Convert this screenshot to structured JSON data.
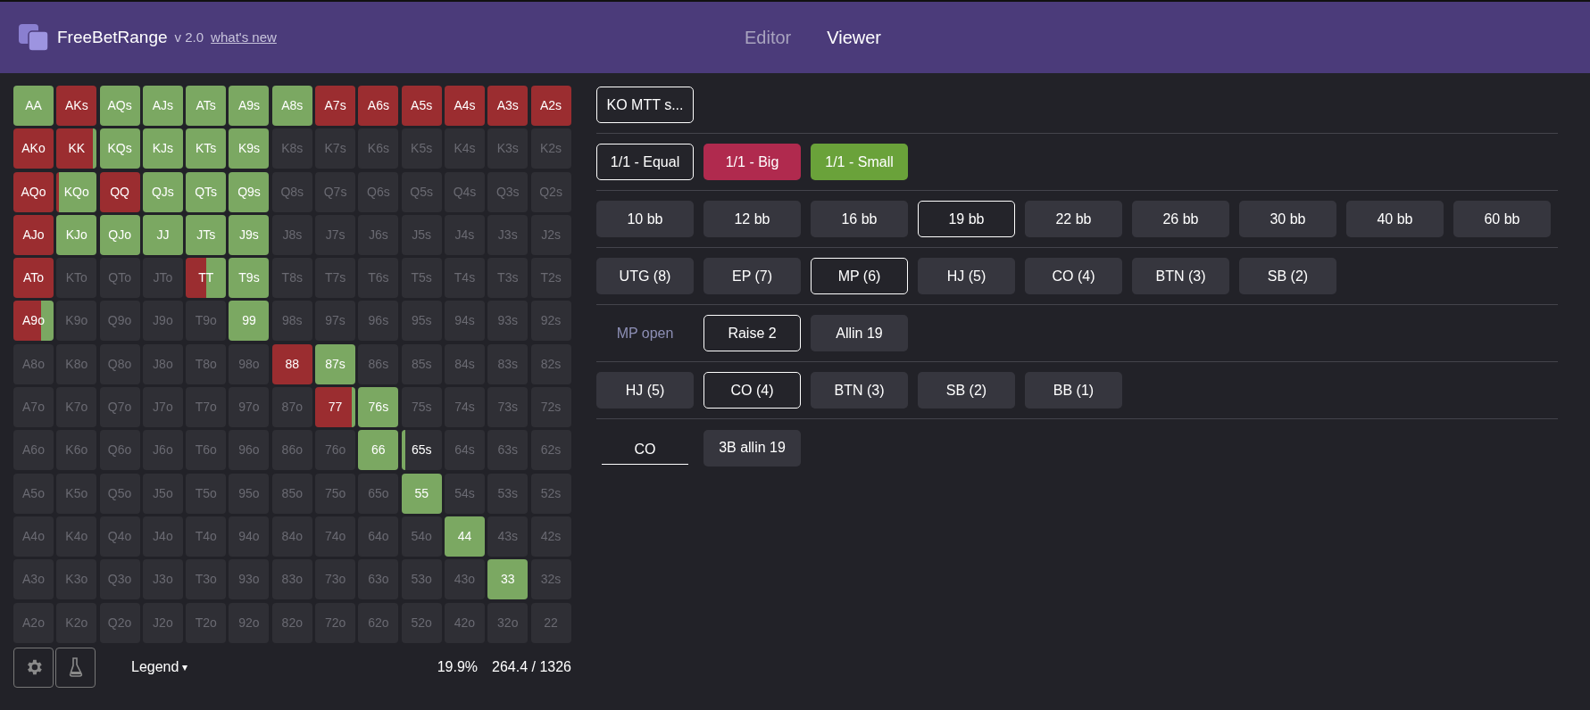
{
  "header": {
    "brand": "FreeBetRange",
    "version": "v 2.0",
    "link": "what's new",
    "tabs": [
      {
        "label": "Editor",
        "selected": false
      },
      {
        "label": "Viewer",
        "selected": true
      }
    ]
  },
  "grid": [
    [
      {
        "label": "AA",
        "actions": [
          {
            "color": "#7ba862",
            "level": 1
          }
        ]
      },
      {
        "label": "AKs",
        "actions": [
          {
            "color": "#9b2d30",
            "level": 1
          }
        ]
      },
      {
        "label": "AQs",
        "actions": [
          {
            "color": "#7ba862",
            "level": 1
          }
        ]
      },
      {
        "label": "AJs",
        "actions": [
          {
            "color": "#7ba862",
            "level": 1
          }
        ]
      },
      {
        "label": "ATs",
        "actions": [
          {
            "color": "#7ba862",
            "level": 1
          }
        ]
      },
      {
        "label": "A9s",
        "actions": [
          {
            "color": "#7ba862",
            "level": 1
          }
        ]
      },
      {
        "label": "A8s",
        "actions": [
          {
            "color": "#7ba862",
            "level": 1
          }
        ]
      },
      {
        "label": "A7s",
        "actions": [
          {
            "color": "#9b2d30",
            "level": 1
          }
        ]
      },
      {
        "label": "A6s",
        "actions": [
          {
            "color": "#9b2d30",
            "level": 1
          }
        ]
      },
      {
        "label": "A5s",
        "actions": [
          {
            "color": "#9b2d30",
            "level": 1
          }
        ]
      },
      {
        "label": "A4s",
        "actions": [
          {
            "color": "#9b2d30",
            "level": 1
          }
        ]
      },
      {
        "label": "A3s",
        "actions": [
          {
            "color": "#9b2d30",
            "level": 1
          }
        ]
      },
      {
        "label": "A2s",
        "actions": [
          {
            "color": "#9b2d30",
            "level": 1
          }
        ]
      }
    ],
    [
      {
        "label": "AKo",
        "actions": [
          {
            "color": "#9b2d30",
            "level": 1
          }
        ]
      },
      {
        "label": "KK",
        "actions": [
          {
            "color": "#9b2d30",
            "level": 0.9
          },
          {
            "color": "#7ba862",
            "level": 0.1
          }
        ]
      },
      {
        "label": "KQs",
        "actions": [
          {
            "color": "#7ba862",
            "level": 1
          }
        ]
      },
      {
        "label": "KJs",
        "actions": [
          {
            "color": "#7ba862",
            "level": 1
          }
        ]
      },
      {
        "label": "KTs",
        "actions": [
          {
            "color": "#7ba862",
            "level": 1
          }
        ]
      },
      {
        "label": "K9s",
        "actions": [
          {
            "color": "#7ba862",
            "level": 1
          }
        ]
      },
      {
        "label": "K8s"
      },
      {
        "label": "K7s"
      },
      {
        "label": "K6s"
      },
      {
        "label": "K5s"
      },
      {
        "label": "K4s"
      },
      {
        "label": "K3s"
      },
      {
        "label": "K2s"
      }
    ],
    [
      {
        "label": "AQo",
        "actions": [
          {
            "color": "#9b2d30",
            "level": 1
          }
        ]
      },
      {
        "label": "KQo",
        "actions": [
          {
            "color": "#9b2d30",
            "level": 0.05
          },
          {
            "color": "#7ba862",
            "level": 0.95
          }
        ]
      },
      {
        "label": "QQ",
        "actions": [
          {
            "color": "#9b2d30",
            "level": 1
          }
        ]
      },
      {
        "label": "QJs",
        "actions": [
          {
            "color": "#7ba862",
            "level": 1
          }
        ]
      },
      {
        "label": "QTs",
        "actions": [
          {
            "color": "#7ba862",
            "level": 1
          }
        ]
      },
      {
        "label": "Q9s",
        "actions": [
          {
            "color": "#7ba862",
            "level": 1
          }
        ]
      },
      {
        "label": "Q8s"
      },
      {
        "label": "Q7s"
      },
      {
        "label": "Q6s"
      },
      {
        "label": "Q5s"
      },
      {
        "label": "Q4s"
      },
      {
        "label": "Q3s"
      },
      {
        "label": "Q2s"
      }
    ],
    [
      {
        "label": "AJo",
        "actions": [
          {
            "color": "#9b2d30",
            "level": 1
          }
        ]
      },
      {
        "label": "KJo",
        "actions": [
          {
            "color": "#7ba862",
            "level": 1
          }
        ]
      },
      {
        "label": "QJo",
        "actions": [
          {
            "color": "#7ba862",
            "level": 1
          }
        ]
      },
      {
        "label": "JJ",
        "actions": [
          {
            "color": "#7ba862",
            "level": 1
          }
        ]
      },
      {
        "label": "JTs",
        "actions": [
          {
            "color": "#7ba862",
            "level": 1
          }
        ]
      },
      {
        "label": "J9s",
        "actions": [
          {
            "color": "#7ba862",
            "level": 1
          }
        ]
      },
      {
        "label": "J8s"
      },
      {
        "label": "J7s"
      },
      {
        "label": "J6s"
      },
      {
        "label": "J5s"
      },
      {
        "label": "J4s"
      },
      {
        "label": "J3s"
      },
      {
        "label": "J2s"
      }
    ],
    [
      {
        "label": "ATo",
        "actions": [
          {
            "color": "#9b2d30",
            "level": 1
          }
        ]
      },
      {
        "label": "KTo"
      },
      {
        "label": "QTo"
      },
      {
        "label": "JTo"
      },
      {
        "label": "TT",
        "actions": [
          {
            "color": "#9b2d30",
            "level": 0.5
          },
          {
            "color": "#7ba862",
            "level": 0.5
          }
        ]
      },
      {
        "label": "T9s",
        "actions": [
          {
            "color": "#7ba862",
            "level": 1
          }
        ]
      },
      {
        "label": "T8s"
      },
      {
        "label": "T7s"
      },
      {
        "label": "T6s"
      },
      {
        "label": "T5s"
      },
      {
        "label": "T4s"
      },
      {
        "label": "T3s"
      },
      {
        "label": "T2s"
      }
    ],
    [
      {
        "label": "A9o",
        "actions": [
          {
            "color": "#9b2d30",
            "level": 0.68
          },
          {
            "color": "#7ba862",
            "level": 0.32
          }
        ]
      },
      {
        "label": "K9o"
      },
      {
        "label": "Q9o"
      },
      {
        "label": "J9o"
      },
      {
        "label": "T9o"
      },
      {
        "label": "99",
        "actions": [
          {
            "color": "#7ba862",
            "level": 1
          }
        ]
      },
      {
        "label": "98s"
      },
      {
        "label": "97s"
      },
      {
        "label": "96s"
      },
      {
        "label": "95s"
      },
      {
        "label": "94s"
      },
      {
        "label": "93s"
      },
      {
        "label": "92s"
      }
    ],
    [
      {
        "label": "A8o"
      },
      {
        "label": "K8o"
      },
      {
        "label": "Q8o"
      },
      {
        "label": "J8o"
      },
      {
        "label": "T8o"
      },
      {
        "label": "98o"
      },
      {
        "label": "88",
        "actions": [
          {
            "color": "#9b2d30",
            "level": 1
          }
        ]
      },
      {
        "label": "87s",
        "actions": [
          {
            "color": "#7ba862",
            "level": 1
          }
        ]
      },
      {
        "label": "86s"
      },
      {
        "label": "85s"
      },
      {
        "label": "84s"
      },
      {
        "label": "83s"
      },
      {
        "label": "82s"
      }
    ],
    [
      {
        "label": "A7o"
      },
      {
        "label": "K7o"
      },
      {
        "label": "Q7o"
      },
      {
        "label": "J7o"
      },
      {
        "label": "T7o"
      },
      {
        "label": "97o"
      },
      {
        "label": "87o"
      },
      {
        "label": "77",
        "actions": [
          {
            "color": "#9b2d30",
            "level": 0.9
          },
          {
            "color": "#7ba862",
            "level": 0.1
          }
        ]
      },
      {
        "label": "76s",
        "actions": [
          {
            "color": "#7ba862",
            "level": 1
          }
        ]
      },
      {
        "label": "75s"
      },
      {
        "label": "74s"
      },
      {
        "label": "73s"
      },
      {
        "label": "72s"
      }
    ],
    [
      {
        "label": "A6o"
      },
      {
        "label": "K6o"
      },
      {
        "label": "Q6o"
      },
      {
        "label": "J6o"
      },
      {
        "label": "T6o"
      },
      {
        "label": "96o"
      },
      {
        "label": "86o"
      },
      {
        "label": "76o"
      },
      {
        "label": "66",
        "actions": [
          {
            "color": "#7ba862",
            "level": 1
          }
        ]
      },
      {
        "label": "65s",
        "actions": [
          {
            "color": "#7ba862",
            "level": 0.1
          }
        ]
      },
      {
        "label": "64s"
      },
      {
        "label": "63s"
      },
      {
        "label": "62s"
      }
    ],
    [
      {
        "label": "A5o"
      },
      {
        "label": "K5o"
      },
      {
        "label": "Q5o"
      },
      {
        "label": "J5o"
      },
      {
        "label": "T5o"
      },
      {
        "label": "95o"
      },
      {
        "label": "85o"
      },
      {
        "label": "75o"
      },
      {
        "label": "65o"
      },
      {
        "label": "55",
        "actions": [
          {
            "color": "#7ba862",
            "level": 1
          }
        ]
      },
      {
        "label": "54s"
      },
      {
        "label": "53s"
      },
      {
        "label": "52s"
      }
    ],
    [
      {
        "label": "A4o"
      },
      {
        "label": "K4o"
      },
      {
        "label": "Q4o"
      },
      {
        "label": "J4o"
      },
      {
        "label": "T4o"
      },
      {
        "label": "94o"
      },
      {
        "label": "84o"
      },
      {
        "label": "74o"
      },
      {
        "label": "64o"
      },
      {
        "label": "54o"
      },
      {
        "label": "44",
        "actions": [
          {
            "color": "#7ba862",
            "level": 1
          }
        ]
      },
      {
        "label": "43s"
      },
      {
        "label": "42s"
      }
    ],
    [
      {
        "label": "A3o"
      },
      {
        "label": "K3o"
      },
      {
        "label": "Q3o"
      },
      {
        "label": "J3o"
      },
      {
        "label": "T3o"
      },
      {
        "label": "93o"
      },
      {
        "label": "83o"
      },
      {
        "label": "73o"
      },
      {
        "label": "63o"
      },
      {
        "label": "53o"
      },
      {
        "label": "43o"
      },
      {
        "label": "33",
        "actions": [
          {
            "color": "#7ba862",
            "level": 1
          }
        ]
      },
      {
        "label": "32s"
      }
    ],
    [
      {
        "label": "A2o"
      },
      {
        "label": "K2o"
      },
      {
        "label": "Q2o"
      },
      {
        "label": "J2o"
      },
      {
        "label": "T2o"
      },
      {
        "label": "92o"
      },
      {
        "label": "82o"
      },
      {
        "label": "72o"
      },
      {
        "label": "62o"
      },
      {
        "label": "52o"
      },
      {
        "label": "42o"
      },
      {
        "label": "32o"
      },
      {
        "label": "22"
      }
    ]
  ],
  "footer": {
    "legend": "Legend",
    "caret": "▾",
    "percent": "19.9%",
    "combos": "264.4 / 1326"
  },
  "rows": [
    {
      "kind": "buttons",
      "options": [
        {
          "label": "KO MTT s...",
          "selected": true
        }
      ]
    },
    {
      "kind": "buttons",
      "options": [
        {
          "label": "1/1 - Equal",
          "selected": true
        },
        {
          "label": "1/1 - Big",
          "selected": false,
          "color": "#b02a4e"
        },
        {
          "label": "1/1 - Small",
          "selected": false,
          "color": "#6aa23a"
        }
      ]
    },
    {
      "kind": "buttons",
      "options": [
        {
          "label": "10 bb",
          "selected": false
        },
        {
          "label": "12 bb",
          "selected": false
        },
        {
          "label": "16 bb",
          "selected": false
        },
        {
          "label": "19 bb",
          "selected": true
        },
        {
          "label": "22 bb",
          "selected": false
        },
        {
          "label": "26 bb",
          "selected": false
        },
        {
          "label": "30 bb",
          "selected": false
        },
        {
          "label": "40 bb",
          "selected": false
        },
        {
          "label": "60 bb",
          "selected": false
        }
      ]
    },
    {
      "kind": "buttons",
      "options": [
        {
          "label": "UTG (8)",
          "selected": false
        },
        {
          "label": "EP (7)",
          "selected": false
        },
        {
          "label": "MP (6)",
          "selected": true
        },
        {
          "label": "HJ (5)",
          "selected": false
        },
        {
          "label": "CO (4)",
          "selected": false
        },
        {
          "label": "BTN (3)",
          "selected": false
        },
        {
          "label": "SB (2)",
          "selected": false
        }
      ]
    },
    {
      "kind": "labeled",
      "label": "MP open",
      "options": [
        {
          "label": "Raise 2",
          "selected": true
        },
        {
          "label": "Allin 19",
          "selected": false
        }
      ]
    },
    {
      "kind": "buttons",
      "options": [
        {
          "label": "HJ (5)",
          "selected": false
        },
        {
          "label": "CO (4)",
          "selected": true
        },
        {
          "label": "BTN (3)",
          "selected": false
        },
        {
          "label": "SB (2)",
          "selected": false
        },
        {
          "label": "BB (1)",
          "selected": false
        }
      ]
    },
    {
      "kind": "underlined",
      "label": "CO",
      "options": [
        {
          "label": "3B allin 19",
          "selected": false
        }
      ]
    }
  ]
}
